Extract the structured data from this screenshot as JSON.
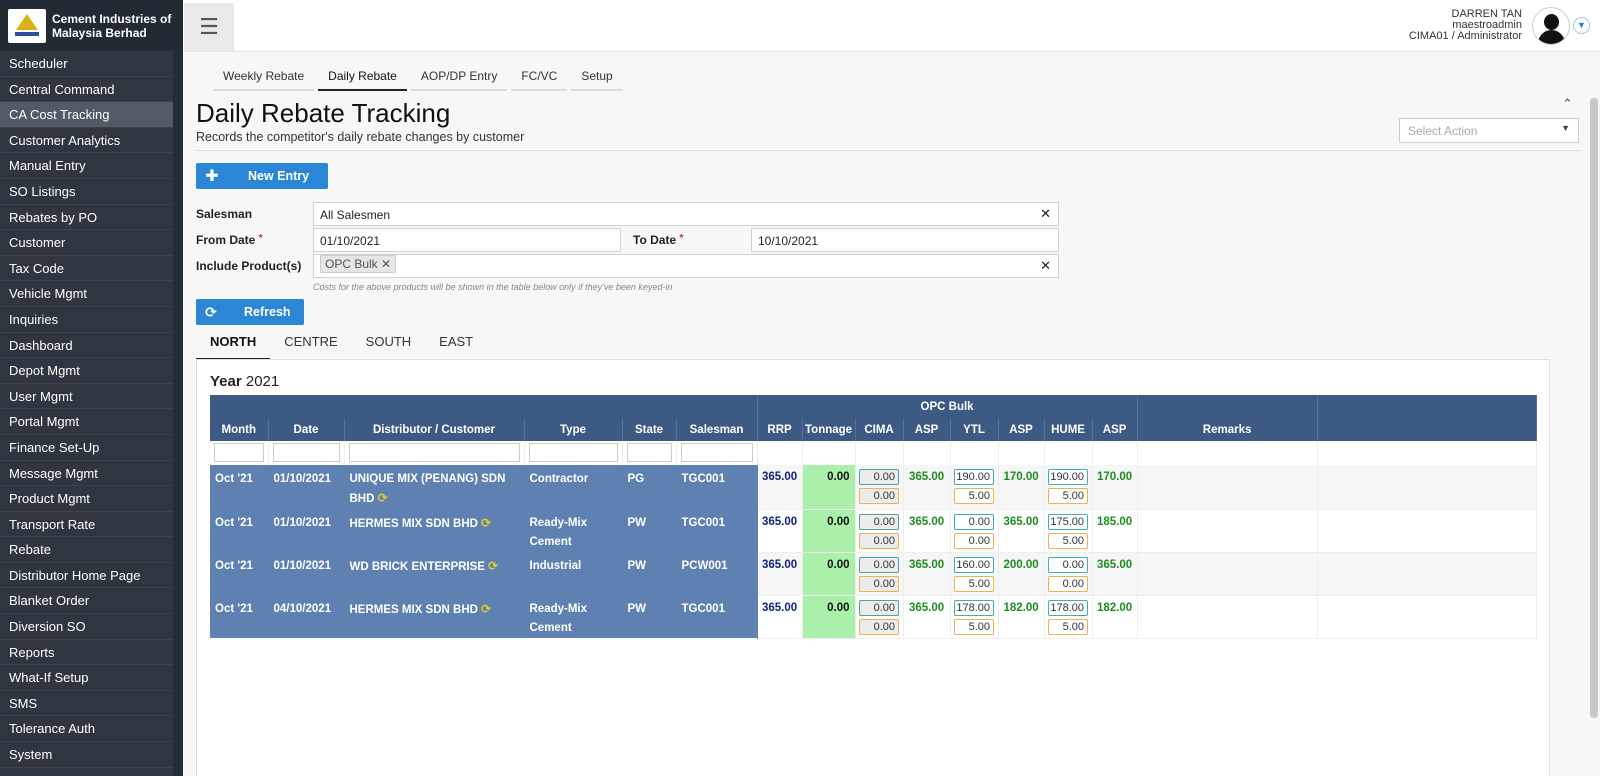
{
  "brand": {
    "name": "Cement Industries of Malaysia Berhad"
  },
  "sidebar": {
    "items": [
      {
        "label": "Scheduler"
      },
      {
        "label": "Central Command"
      },
      {
        "label": "CA Cost Tracking"
      },
      {
        "label": "Customer Analytics"
      },
      {
        "label": "Manual Entry"
      },
      {
        "label": "SO Listings"
      },
      {
        "label": "Rebates by PO"
      },
      {
        "label": "Customer"
      },
      {
        "label": "Tax Code"
      },
      {
        "label": "Vehicle Mgmt"
      },
      {
        "label": "Inquiries"
      },
      {
        "label": "Dashboard"
      },
      {
        "label": "Depot Mgmt"
      },
      {
        "label": "User Mgmt"
      },
      {
        "label": "Portal Mgmt"
      },
      {
        "label": "Finance Set-Up"
      },
      {
        "label": "Message Mgmt"
      },
      {
        "label": "Product Mgmt"
      },
      {
        "label": "Transport Rate"
      },
      {
        "label": "Rebate"
      },
      {
        "label": "Distributor Home Page"
      },
      {
        "label": "Blanket Order"
      },
      {
        "label": "Diversion SO"
      },
      {
        "label": "Reports"
      },
      {
        "label": "What-If Setup"
      },
      {
        "label": "SMS"
      },
      {
        "label": "Tolerance Auth"
      },
      {
        "label": "System"
      }
    ],
    "active_index": 2
  },
  "header": {
    "user_name": "DARREN TAN",
    "user_login": "maestroadmin",
    "user_role": "CIMA01 / Administrator"
  },
  "page_tabs": [
    {
      "label": "Weekly Rebate"
    },
    {
      "label": "Daily Rebate"
    },
    {
      "label": "AOP/DP Entry"
    },
    {
      "label": "FC/VC"
    },
    {
      "label": "Setup"
    }
  ],
  "page": {
    "title": "Daily Rebate Tracking",
    "subtitle": "Records the competitor's daily rebate changes by customer",
    "select_action_placeholder": "Select Action",
    "new_entry_label": "New Entry",
    "refresh_label": "Refresh"
  },
  "filters": {
    "salesman_label": "Salesman",
    "salesman_value": "All Salesmen",
    "from_date_label": "From Date",
    "from_date_value": "01/10/2021",
    "to_date_label": "To Date",
    "to_date_value": "10/10/2021",
    "products_label": "Include Product(s)",
    "product_chip": "OPC Bulk",
    "help_text": "Costs for the above products will be shown in the table below only if they've been keyed-in"
  },
  "region_tabs": [
    {
      "label": "NORTH"
    },
    {
      "label": "CENTRE"
    },
    {
      "label": "SOUTH"
    },
    {
      "label": "EAST"
    }
  ],
  "table": {
    "year_word": "Year",
    "year_value": "2021",
    "group_header": "OPC Bulk",
    "headers": [
      "Month",
      "Date",
      "Distributor / Customer",
      "Type",
      "State",
      "Salesman",
      "RRP",
      "Tonnage",
      "CIMA",
      "ASP",
      "YTL",
      "ASP",
      "HUME",
      "ASP",
      "Remarks"
    ],
    "rows": [
      {
        "month": "Oct '21",
        "date": "01/10/2021",
        "customer": "UNIQUE MIX (PENANG) SDN BHD",
        "type": "Contractor",
        "state": "PG",
        "salesman": "TGC001",
        "rrp": "365.00",
        "tonnage": "0.00",
        "cima_top": "0.00",
        "cima_bot": "0.00",
        "cima_asp": "365.00",
        "ytl_top": "190.00",
        "ytl_bot": "5.00",
        "ytl_asp": "170.00",
        "hume_top": "190.00",
        "hume_bot": "5.00",
        "hume_asp": "170.00"
      },
      {
        "month": "Oct '21",
        "date": "01/10/2021",
        "customer": "HERMES MIX SDN BHD",
        "type": "Ready-Mix Cement",
        "state": "PW",
        "salesman": "TGC001",
        "rrp": "365.00",
        "tonnage": "0.00",
        "cima_top": "0.00",
        "cima_bot": "0.00",
        "cima_asp": "365.00",
        "ytl_top": "0.00",
        "ytl_bot": "0.00",
        "ytl_asp": "365.00",
        "hume_top": "175.00",
        "hume_bot": "5.00",
        "hume_asp": "185.00"
      },
      {
        "month": "Oct '21",
        "date": "01/10/2021",
        "customer": "WD BRICK ENTERPRISE",
        "type": "Industrial",
        "state": "PW",
        "salesman": "PCW001",
        "rrp": "365.00",
        "tonnage": "0.00",
        "cima_top": "0.00",
        "cima_bot": "0.00",
        "cima_asp": "365.00",
        "ytl_top": "160.00",
        "ytl_bot": "5.00",
        "ytl_asp": "200.00",
        "hume_top": "0.00",
        "hume_bot": "0.00",
        "hume_asp": "365.00"
      },
      {
        "month": "Oct '21",
        "date": "04/10/2021",
        "customer": "HERMES MIX SDN BHD",
        "type": "Ready-Mix Cement",
        "state": "PW",
        "salesman": "TGC001",
        "rrp": "365.00",
        "tonnage": "0.00",
        "cima_top": "0.00",
        "cima_bot": "0.00",
        "cima_asp": "365.00",
        "ytl_top": "178.00",
        "ytl_bot": "5.00",
        "ytl_asp": "182.00",
        "hume_top": "178.00",
        "hume_bot": "5.00",
        "hume_asp": "182.00"
      }
    ]
  },
  "colors": {
    "sidebar_bg": "#2f3640",
    "primary": "#2b87d5",
    "table_header": "#3d5a85",
    "row_left": "#5f81b2",
    "tonnage_bg": "#aaf0aa",
    "asp_green": "#1e8c1e",
    "rrp_navy": "#10237a"
  },
  "icons": {
    "menu": "hamburger-icon",
    "plus": "plus-icon",
    "refresh": "refresh-icon",
    "sync": "sync-icon",
    "clear": "clear-icon",
    "user_dropdown": "chevron-down-icon"
  }
}
